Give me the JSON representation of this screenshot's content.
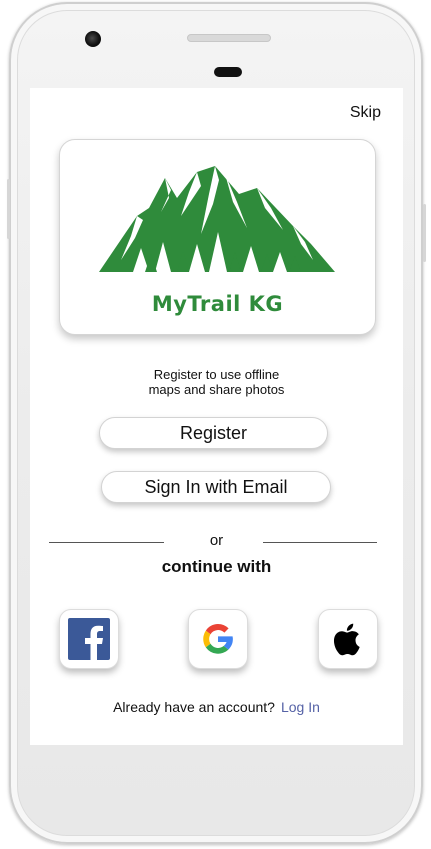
{
  "top_bar": {
    "skip_label": "Skip"
  },
  "logo": {
    "brand_name": "MyTrail KG",
    "icon": "mountain-icon",
    "brand_color": "#2f8b3b"
  },
  "intro": {
    "tagline": "Register  to use offline\nmaps and share photos"
  },
  "actions": {
    "register_label": "Register",
    "email_signin_label": "Sign In with Email"
  },
  "separator": {
    "or_label": "or",
    "continue_label": "continue with"
  },
  "social": [
    {
      "name": "Facebook",
      "icon": "facebook-icon",
      "color": "#3b5998"
    },
    {
      "name": "Google",
      "icon": "google-icon",
      "color": "#4285f4"
    },
    {
      "name": "Apple",
      "icon": "apple-icon",
      "color": "#000000"
    }
  ],
  "footer": {
    "prompt": "Already have an account?",
    "login_label": "Log In",
    "link_color": "#5562a6"
  }
}
